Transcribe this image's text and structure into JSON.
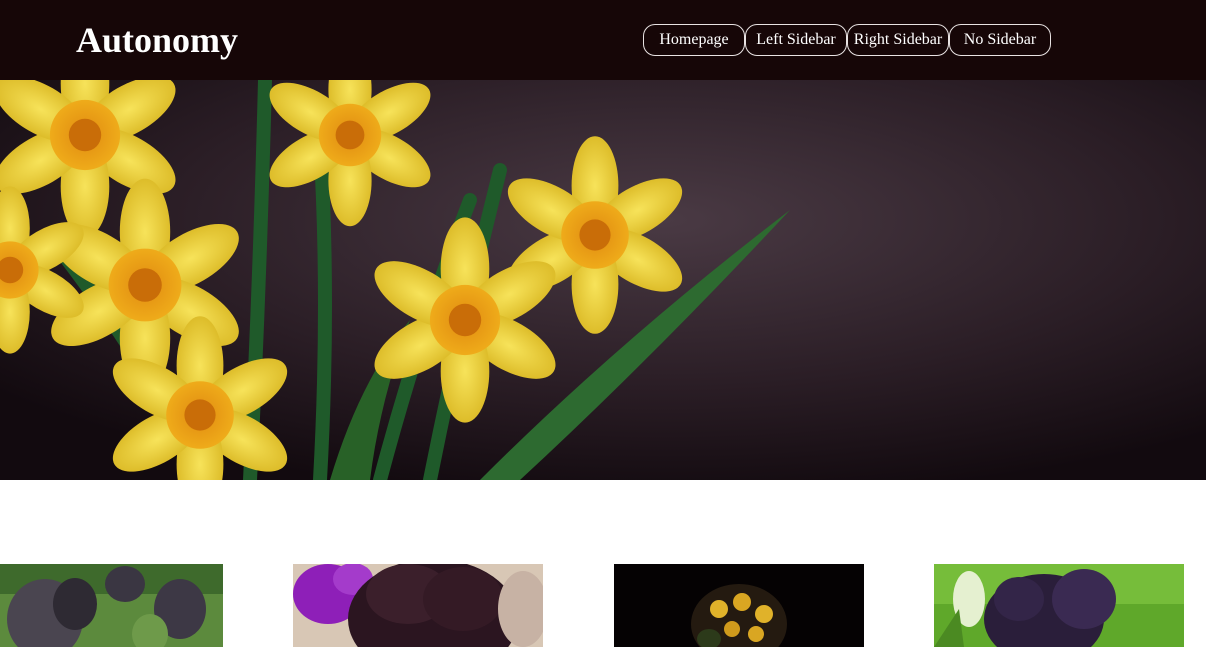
{
  "site": {
    "title": "Autonomy"
  },
  "nav": {
    "items": [
      {
        "label": "Homepage"
      },
      {
        "label": "Left Sidebar"
      },
      {
        "label": "Right Sidebar"
      },
      {
        "label": "No Sidebar"
      }
    ]
  },
  "colors": {
    "header_bg": "#160607",
    "nav_border": "#e8e2e2",
    "text_light": "#ffffff"
  },
  "hero": {
    "image": "daffodils-on-dark-background"
  },
  "gallery": {
    "items": [
      {
        "image": "dark-pansies-in-garden"
      },
      {
        "image": "dark-pansy-with-purple-violet"
      },
      {
        "image": "dark-primula-flower"
      },
      {
        "image": "dark-purple-pansy-green-background"
      }
    ]
  }
}
